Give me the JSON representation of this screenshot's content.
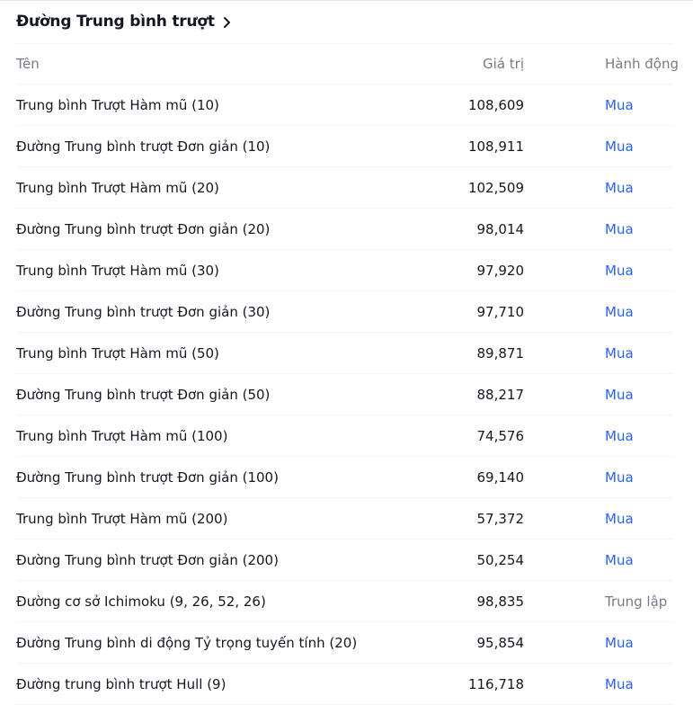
{
  "section": {
    "title": "Đường Trung bình trượt"
  },
  "table": {
    "headers": {
      "name": "Tên",
      "value": "Giá trị",
      "action": "Hành động"
    },
    "rows": [
      {
        "name": "Trung bình Trượt Hàm mũ (10)",
        "value": "108,609",
        "action": "Mua",
        "status": "buy"
      },
      {
        "name": "Đường Trung bình trượt Đơn giản (10)",
        "value": "108,911",
        "action": "Mua",
        "status": "buy"
      },
      {
        "name": "Trung bình Trượt Hàm mũ (20)",
        "value": "102,509",
        "action": "Mua",
        "status": "buy"
      },
      {
        "name": "Đường Trung bình trượt Đơn giản (20)",
        "value": "98,014",
        "action": "Mua",
        "status": "buy"
      },
      {
        "name": "Trung bình Trượt Hàm mũ (30)",
        "value": "97,920",
        "action": "Mua",
        "status": "buy"
      },
      {
        "name": "Đường Trung bình trượt Đơn giản (30)",
        "value": "97,710",
        "action": "Mua",
        "status": "buy"
      },
      {
        "name": "Trung bình Trượt Hàm mũ (50)",
        "value": "89,871",
        "action": "Mua",
        "status": "buy"
      },
      {
        "name": "Đường Trung bình trượt Đơn giản (50)",
        "value": "88,217",
        "action": "Mua",
        "status": "buy"
      },
      {
        "name": "Trung bình Trượt Hàm mũ (100)",
        "value": "74,576",
        "action": "Mua",
        "status": "buy"
      },
      {
        "name": "Đường Trung bình trượt Đơn giản (100)",
        "value": "69,140",
        "action": "Mua",
        "status": "buy"
      },
      {
        "name": "Trung bình Trượt Hàm mũ (200)",
        "value": "57,372",
        "action": "Mua",
        "status": "buy"
      },
      {
        "name": "Đường Trung bình trượt Đơn giản (200)",
        "value": "50,254",
        "action": "Mua",
        "status": "buy"
      },
      {
        "name": "Đường cơ sở Ichimoku (9, 26, 52, 26)",
        "value": "98,835",
        "action": "Trung lập",
        "status": "neutral"
      },
      {
        "name": "Đường Trung bình di động Tỷ trọng tuyến tính (20)",
        "value": "95,854",
        "action": "Mua",
        "status": "buy"
      },
      {
        "name": "Đường trung bình trượt Hull (9)",
        "value": "116,718",
        "action": "Mua",
        "status": "buy"
      }
    ]
  },
  "colors": {
    "buy": "#2962ff",
    "neutral": "#787b86",
    "text": "#131722",
    "header_text": "#787b86",
    "divider": "#f0f3fa"
  },
  "icons": {
    "title_chevron": "chevron-right-icon"
  }
}
